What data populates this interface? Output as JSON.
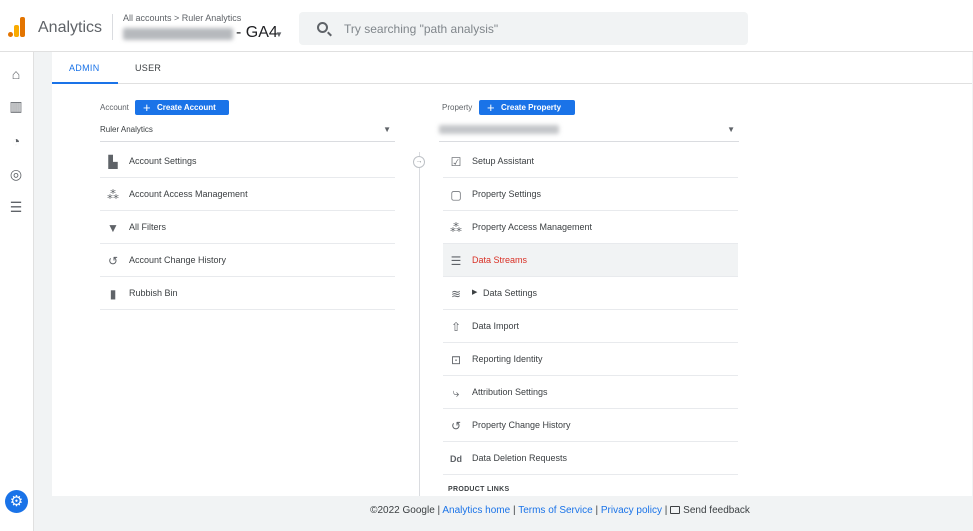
{
  "header": {
    "app_name": "Analytics",
    "breadcrumb": "All accounts > Ruler Analytics",
    "property_suffix": "- GA4",
    "search_placeholder": "Try searching \"path analysis\""
  },
  "rail": {
    "icons": [
      "home-icon",
      "reports-icon",
      "explore-icon",
      "advertising-icon",
      "configure-icon"
    ],
    "settings_icon": "gear-icon"
  },
  "tabs": [
    {
      "label": "ADMIN",
      "active": true
    },
    {
      "label": "USER",
      "active": false
    }
  ],
  "account": {
    "label": "Account",
    "create_label": "Create Account",
    "selected": "Ruler Analytics",
    "items": [
      {
        "label": "Account Settings",
        "icon": "building-icon"
      },
      {
        "label": "Account Access Management",
        "icon": "people-icon"
      },
      {
        "label": "All Filters",
        "icon": "filter-icon"
      },
      {
        "label": "Account Change History",
        "icon": "history-icon"
      },
      {
        "label": "Rubbish Bin",
        "icon": "trash-icon"
      }
    ]
  },
  "property": {
    "label": "Property",
    "create_label": "Create Property",
    "items": [
      {
        "label": "Setup Assistant",
        "icon": "checkbox-icon"
      },
      {
        "label": "Property Settings",
        "icon": "window-icon"
      },
      {
        "label": "Property Access Management",
        "icon": "people-icon"
      },
      {
        "label": "Data Streams",
        "icon": "streams-icon",
        "active": true
      },
      {
        "label": "Data Settings",
        "icon": "database-icon"
      },
      {
        "label": "Data Import",
        "icon": "upload-icon"
      },
      {
        "label": "Reporting Identity",
        "icon": "identity-icon"
      },
      {
        "label": "Attribution Settings",
        "icon": "attribution-icon"
      },
      {
        "label": "Property Change History",
        "icon": "history-icon"
      },
      {
        "label": "Data Deletion Requests",
        "icon": "dd-icon"
      }
    ],
    "section_heading": "PRODUCT LINKS"
  },
  "footer": {
    "copyright": "©2022 Google",
    "sep": "|",
    "links": [
      "Analytics home",
      "Terms of Service",
      "Privacy policy"
    ],
    "feedback": "Send feedback"
  },
  "colors": {
    "accent": "#1a73e8",
    "active_text": "#d93025",
    "logo_orange": "#e37400",
    "logo_yellow": "#f9ab00"
  }
}
